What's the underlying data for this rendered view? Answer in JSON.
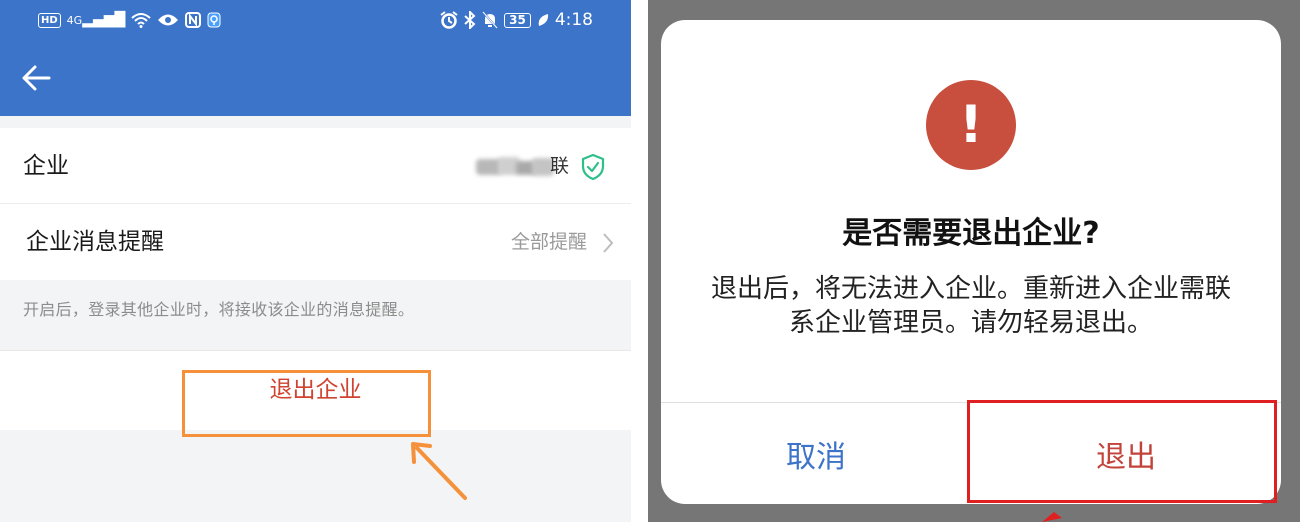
{
  "statusbar": {
    "left_hd": "HD",
    "left_signal": "4G",
    "right_battery": "35",
    "time": "4:18"
  },
  "left_screen": {
    "rows": {
      "company_label": "企业",
      "company_value_hidden": "联",
      "notify_label": "企业消息提醒",
      "notify_value": "全部提醒"
    },
    "hint": "开启后，登录其他企业时，将接收该企业的消息提醒。",
    "exit_button": "退出企业"
  },
  "dialog": {
    "title": "是否需要退出企业?",
    "message": "退出后，将无法进入企业。重新进入企业需联系企业管理员。请勿轻易退出。",
    "cancel_label": "取消",
    "exit_label": "退出"
  },
  "colors": {
    "app_bar": "#3b74c9",
    "exit_red": "#cf4330",
    "alert_red": "#c84e3d",
    "cancel_blue": "#3d73c9",
    "highlight_orange": "#f5913a",
    "highlight_red": "#e02020",
    "verified_green": "#2fbf8a"
  },
  "icons": {
    "back": "arrow-left-icon",
    "verified": "shield-check-icon",
    "chevron": "chevron-right-icon",
    "alert": "exclamation-icon"
  }
}
